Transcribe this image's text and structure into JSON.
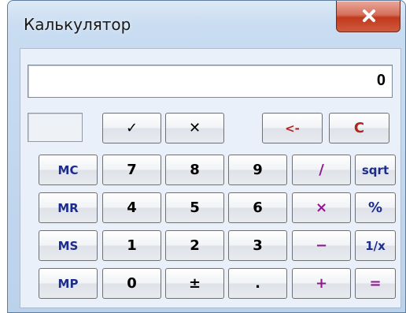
{
  "window": {
    "title": "Калькулятор"
  },
  "display": {
    "value": "0"
  },
  "colors": {
    "memory": "#1c2c8c",
    "operator": "#8e1a8c",
    "edit": "#b0261f",
    "digit": "#000000"
  },
  "buttons": {
    "check": "✓",
    "clear_entry": "✕",
    "backspace": "<-",
    "clear": "C",
    "mc": "MC",
    "mr": "MR",
    "ms": "MS",
    "mp": "MP",
    "d7": "7",
    "d8": "8",
    "d9": "9",
    "d4": "4",
    "d5": "5",
    "d6": "6",
    "d1": "1",
    "d2": "2",
    "d3": "3",
    "d0": "0",
    "plus_minus": "±",
    "decimal": ".",
    "divide": "/",
    "multiply": "×",
    "minus": "−",
    "plus": "+",
    "sqrt": "sqrt",
    "percent": "%",
    "reciprocal": "1/x",
    "equals": "="
  }
}
